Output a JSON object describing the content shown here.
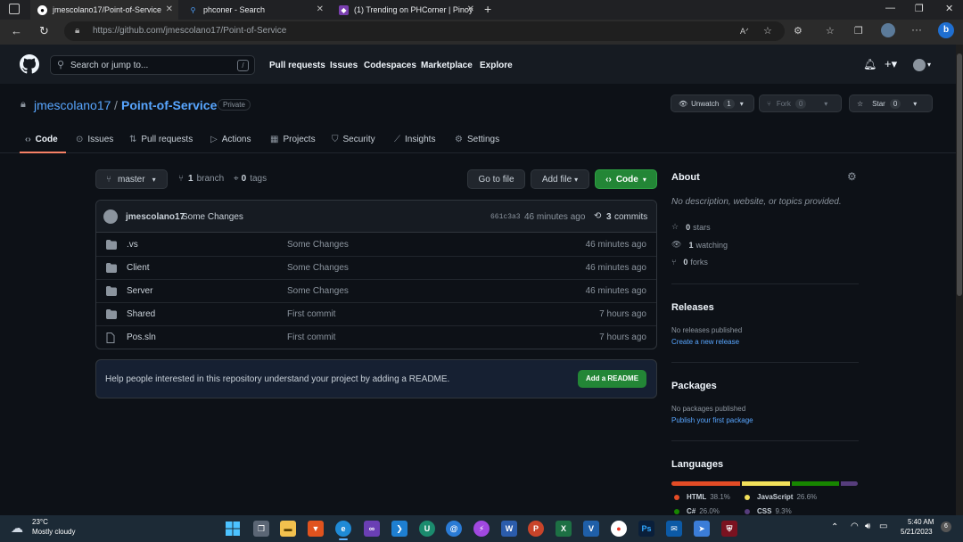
{
  "browser": {
    "tabs": [
      {
        "title": "jmescolano17/Point-of-Service",
        "active": true
      },
      {
        "title": "phconer - Search",
        "active": false
      },
      {
        "title": "(1) Trending on PHCorner | Pinoy",
        "active": false
      }
    ],
    "url": "https://github.com/jmescolano17/Point-of-Service"
  },
  "header": {
    "search_placeholder": "Search or jump to...",
    "search_key": "/",
    "nav": [
      "Pull requests",
      "Issues",
      "Codespaces",
      "Marketplace",
      "Explore"
    ]
  },
  "repo": {
    "owner": "jmescolano17",
    "separator": "/",
    "name": "Point-of-Service",
    "visibility": "Private",
    "watch_label": "Unwatch",
    "watch_count": "1",
    "fork_label": "Fork",
    "fork_count": "0",
    "star_label": "Star",
    "star_count": "0"
  },
  "tabs": [
    "Code",
    "Issues",
    "Pull requests",
    "Actions",
    "Projects",
    "Security",
    "Insights",
    "Settings"
  ],
  "toolbar": {
    "branch": "master",
    "branch_count": "1",
    "branch_label": "branch",
    "tag_count": "0",
    "tag_label": "tags",
    "go_to_file": "Go to file",
    "add_file": "Add file",
    "code": "Code"
  },
  "commit": {
    "author": "jmescolano17",
    "message": "Some Changes",
    "sha": "661c3a3",
    "time": "46 minutes ago",
    "count": "3",
    "count_label": "commits"
  },
  "files": [
    {
      "name": ".vs",
      "type": "folder",
      "message": "Some Changes",
      "time": "46 minutes ago"
    },
    {
      "name": "Client",
      "type": "folder",
      "message": "Some Changes",
      "time": "46 minutes ago"
    },
    {
      "name": "Server",
      "type": "folder",
      "message": "Some Changes",
      "time": "46 minutes ago"
    },
    {
      "name": "Shared",
      "type": "folder",
      "message": "First commit",
      "time": "7 hours ago"
    },
    {
      "name": "Pos.sln",
      "type": "file",
      "message": "First commit",
      "time": "7 hours ago"
    }
  ],
  "readme": {
    "text": "Help people interested in this repository understand your project by adding a README.",
    "button": "Add a README"
  },
  "about": {
    "title": "About",
    "description": "No description, website, or topics provided.",
    "stars_count": "0",
    "stars_label": "stars",
    "watching_count": "1",
    "watching_label": "watching",
    "forks_count": "0",
    "forks_label": "forks"
  },
  "releases": {
    "title": "Releases",
    "text": "No releases published",
    "link": "Create a new release"
  },
  "packages": {
    "title": "Packages",
    "text": "No packages published",
    "link": "Publish your first package"
  },
  "languages": {
    "title": "Languages",
    "items": [
      {
        "name": "HTML",
        "percent": "38.1%",
        "value": 38.1,
        "color": "#e34c26"
      },
      {
        "name": "JavaScript",
        "percent": "26.6%",
        "value": 26.6,
        "color": "#f1e05a"
      },
      {
        "name": "C#",
        "percent": "26.0%",
        "value": 26.0,
        "color": "#178600"
      },
      {
        "name": "CSS",
        "percent": "9.3%",
        "value": 9.3,
        "color": "#563d7c"
      }
    ]
  },
  "taskbar": {
    "temperature": "23°C",
    "weather": "Mostly cloudy",
    "time": "5:40 AM",
    "date": "5/21/2023",
    "notifications": "6"
  }
}
